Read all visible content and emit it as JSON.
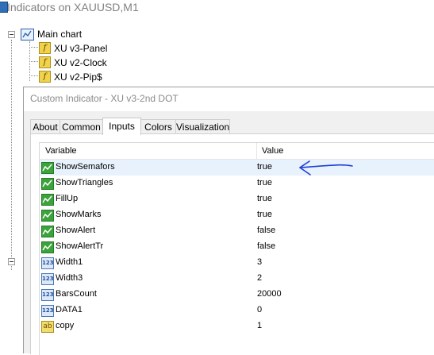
{
  "window": {
    "title": "Indicators on XAUUSD,M1"
  },
  "tree": {
    "main_chart_label": "Main chart",
    "items": [
      {
        "label": "XU v3-Panel"
      },
      {
        "label": "XU v2-Clock"
      },
      {
        "label": "XU v2-Pip$"
      }
    ]
  },
  "dialog": {
    "title": "Custom Indicator - XU v3-2nd DOT",
    "tabs": [
      "About",
      "Common",
      "Inputs",
      "Colors",
      "Visualization"
    ],
    "active_tab": "Inputs",
    "grid": {
      "headers": {
        "variable": "Variable",
        "value": "Value"
      },
      "rows": [
        {
          "variable": "ShowSemafors",
          "value": "true",
          "type": "bool"
        },
        {
          "variable": "ShowTriangles",
          "value": "true",
          "type": "bool"
        },
        {
          "variable": "FillUp",
          "value": "true",
          "type": "bool"
        },
        {
          "variable": "ShowMarks",
          "value": "true",
          "type": "bool"
        },
        {
          "variable": "ShowAlert",
          "value": "false",
          "type": "bool"
        },
        {
          "variable": "ShowAlertTr",
          "value": "false",
          "type": "bool"
        },
        {
          "variable": "Width1",
          "value": "3",
          "type": "num"
        },
        {
          "variable": "Width3",
          "value": "2",
          "type": "num"
        },
        {
          "variable": "BarsCount",
          "value": "20000",
          "type": "num"
        },
        {
          "variable": "DATA1",
          "value": "0",
          "type": "num"
        },
        {
          "variable": "copy",
          "value": "1",
          "type": "str"
        }
      ],
      "selected_row": 0
    }
  },
  "icons": {
    "indicator": "indicator-f-icon",
    "chart": "chart-window-icon",
    "bool": "bool-param-icon",
    "num": "numeric-123-icon",
    "str": "string-ab-icon"
  },
  "colors": {
    "selection": "#e8f2fd",
    "annotation_arrow": "#1f3fd8"
  }
}
